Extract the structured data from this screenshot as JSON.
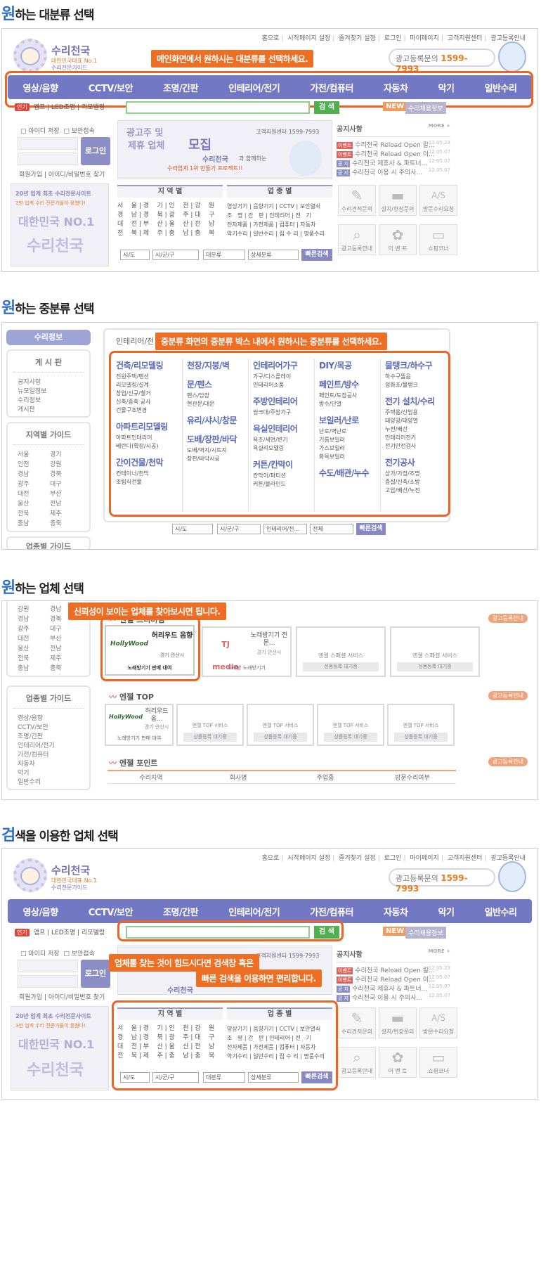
{
  "sections": [
    {
      "title_first": "원",
      "title_rest": "하는 대분류 선택"
    },
    {
      "title_first": "원",
      "title_rest": "하는 중분류 선택"
    },
    {
      "title_first": "원",
      "title_rest": "하는 업체 선택"
    },
    {
      "title_first": "검",
      "title_rest": "색을 이용한 업체 선택"
    }
  ],
  "util_links": [
    "홈으로",
    "시작페이지 설정",
    "즐겨찾기 설정",
    "로그인",
    "마이페이지",
    "고객지원센터",
    "광고등록안내"
  ],
  "logo": {
    "name": "수리천국",
    "tagline1": "대한민국대표 No.1",
    "tagline2": "수리전문가이드"
  },
  "ad_inquiry": {
    "label": "광고등록문의",
    "phone": "1599-7993"
  },
  "callouts": {
    "main": "메인화면에서 원하시는 대분류를 선택하세요.",
    "middle": "중분류 화면의 중분류 박스 내에서 원하시는 중분류를 선택하세요.",
    "company": "신뢰성이 보이는 업체를 찾아보시면 됩니다.",
    "search_line1": "업체를 찾는 것이 힘드시다면 검색창 혹은",
    "search_line2": "빠른 검색을 이용하면 편리합니다."
  },
  "nav": [
    "영상/음향",
    "CCTV/보안",
    "조명/간판",
    "인테리어/전기",
    "가전/컴퓨터",
    "자동차",
    "악기",
    "일반수리"
  ],
  "subrow": {
    "tag": "인기",
    "links": "엡프 | LED조명 | 리모델링"
  },
  "search_button": "검 색",
  "new_badge": "NEW",
  "new_label": "수리채용정보",
  "login": {
    "save_id": "아이디 저장",
    "secure": "보안접속",
    "button": "로그인",
    "links": "회원가입  |  아이디/비밀번호 찾기"
  },
  "promo": {
    "line1": "광고주 및",
    "line2": "제휴 업체",
    "big": "모집",
    "center": "고객지원센터 1599-7993",
    "brand": "수리천국",
    "slogan": "과 함께하는",
    "slogan2": "수리업계 1위 만들기 프로젝트!!"
  },
  "side_promo": {
    "line": "20년 업계 최초 수리전문사이트",
    "line2": "3만 업계 수리 전문가들이 뭉쳤다!",
    "big": "대한민국 NO.1",
    "name": "수리천국"
  },
  "notice": {
    "title": "공지사항",
    "more": "MORE +",
    "rows": [
      {
        "badge": "이벤트",
        "color": "#e2625b",
        "text": "수리천국 Reload Open 칼...",
        "date": "12.05.23"
      },
      {
        "badge": "이벤트",
        "color": "#e2625b",
        "text": "수리천국 Reload Open 이...",
        "date": "12.05.07"
      },
      {
        "badge": "공 지",
        "color": "#8a8fc4",
        "text": "수리천국 제휴사 & 파트너...",
        "date": "12.05.07"
      },
      {
        "badge": "공 지",
        "color": "#8a8fc4",
        "text": "수리천국 이용 시 주의사...",
        "date": "12.05.07"
      }
    ]
  },
  "region": {
    "title": "지 역 별",
    "grid": "서    울 | 경    기 | 인    천 | 강    원\n경    남 | 경    북 | 광    주 | 대    구\n대    전 | 부    산 | 울    산 | 전    남\n전    북 | 제    주 | 충    남 | 충    북"
  },
  "industry": {
    "title": "업 종 별",
    "grid": "영상기기 | 음향기기 | CCTV | 보안열쇠\n조   명 | 간   판 | 인테리어 | 전   기\n전자제품 | 가전제품 | 컴퓨터 | 자동차\n악기수리 | 일반수리 | 집 수 리 | 명품수리"
  },
  "filters": {
    "sido": "시/도",
    "gungu": "시/군/구",
    "major": "대분류",
    "detail": "상세분류",
    "quick": "빠른검색"
  },
  "icons": [
    {
      "name": "wrench-icon",
      "label": "수리견적문의",
      "glyph": "🔧"
    },
    {
      "name": "truck-icon",
      "label": "설치/현장문의",
      "glyph": "🚚"
    },
    {
      "name": "as-icon",
      "label": "방문수리요청",
      "glyph": "A/S"
    },
    {
      "name": "magnifier-icon",
      "label": "광고등록안내",
      "glyph": "🔍"
    },
    {
      "name": "gift-icon",
      "label": "이 벤 트",
      "glyph": "🎁"
    },
    {
      "name": "cart-icon",
      "label": "쇼핑코너",
      "glyph": "🛒"
    }
  ],
  "side_menu": {
    "header": "수리정보",
    "board_title": "게 시 판",
    "board": [
      "공지사항",
      "뉴모일정보",
      "수리정보",
      "게시판"
    ],
    "region_title": "지역별 가이드",
    "regions": [
      [
        "서울",
        "경기"
      ],
      [
        "인천",
        "강원"
      ],
      [
        "경남",
        "경북"
      ],
      [
        "광주",
        "대구"
      ],
      [
        "대전",
        "부산"
      ],
      [
        "울산",
        "전남"
      ],
      [
        "전북",
        "제주"
      ],
      [
        "충남",
        "충북"
      ]
    ],
    "industry_title": "업종별 가이드",
    "industries": [
      "영상/음향",
      "CCTV/보안",
      "조명/간판",
      "인테리어/전기",
      "가전/컴퓨터",
      "자동차",
      "악기",
      "일반수리"
    ]
  },
  "middle_header": "인테리어/전",
  "middle_cols": [
    [
      {
        "g": "건축/리모델링",
        "s": [
          "전원주택/펜션",
          "리모델링/설계",
          "창업/신규/철거",
          "신축/증축 공사",
          "건물구조변경"
        ]
      },
      {
        "g": "아파트리모델링",
        "s": [
          "아파트인테리어",
          "베란다(확장/시공)"
        ]
      },
      {
        "g": "간이건물/천막",
        "s": [
          "컨테이너/천막",
          "조립식건물"
        ]
      }
    ],
    [
      {
        "g": "천장/지붕/벽",
        "s": []
      },
      {
        "g": "문/펜스",
        "s": [
          "펜스/담장",
          "현관문/대문"
        ]
      },
      {
        "g": "유리/샤시/창문",
        "s": []
      },
      {
        "g": "도배/장판/바닥",
        "s": [
          "도배/벽지/시트지",
          "장판/바닥시공"
        ]
      }
    ],
    [
      {
        "g": "인테리어가구",
        "s": [
          "가구/디스플레이",
          "인테리어소품"
        ]
      },
      {
        "g": "주방인테리어",
        "s": [
          "씽크대/주방가구"
        ]
      },
      {
        "g": "욕실인테리어",
        "s": [
          "욕조/세면/변기",
          "욕실리모델링"
        ]
      },
      {
        "g": "커튼/칸막이",
        "s": [
          "칸막이/파티션",
          "커튼/블라인드"
        ]
      }
    ],
    [
      {
        "g": "DIY/목공",
        "s": []
      },
      {
        "g": "페인트/방수",
        "s": [
          "페인트/도장공사",
          "방수/단열"
        ]
      },
      {
        "g": "보일러/난로",
        "s": [
          "난로/벽난로",
          "기름보일러",
          "가스보일러",
          "화목보일러"
        ]
      },
      {
        "g": "수도/배관/누수",
        "s": []
      }
    ],
    [
      {
        "g": "물탱크/하수구",
        "s": [
          "하수구뚫음",
          "정화조/물탱크"
        ]
      },
      {
        "g": "전기 설치/수리",
        "s": [
          "주택용/산업용",
          "태양광/태양열",
          "누전/배선",
          "인테리어전기",
          "전기안전검사"
        ]
      },
      {
        "g": "전기공사",
        "s": [
          "상가/가정/조명",
          "증설/신축/소방",
          "고압/배선/누전"
        ]
      }
    ]
  ],
  "middle_filters": {
    "sido": "시/도",
    "gungu": "시/군/구",
    "major": "인테리어/전...",
    "all": "전체",
    "quick": "빠른검색"
  },
  "company": {
    "angel_premium": "엔젤 프리미엄",
    "angel_top": "엔젤 TOP",
    "angel_point": "엔젤 포인트",
    "reg_badge": "광고등록안내",
    "premium_name": "허리우드 음향",
    "premium_loc": "경기 안산시",
    "premium_cap": "노래방기기 판매 대여",
    "premium_logo": "HollyWood",
    "tj_logo": "TJ media",
    "tj_name": "노래방기기 전문...",
    "tj_loc": "경기 안산시",
    "tj_cap": "노래방 노래방기기",
    "service_title": "엔젤 스페셜 서비스",
    "service_cap": "상품등록 대기중",
    "top_name": "허리우드 음...",
    "top_loc": "경기 안산시",
    "top_cap": "노래방기기 판매 대여",
    "top_service": "엔젤 TOP 서비스",
    "top_service_cap": "상품등록 대기중",
    "point_cols": [
      "수리지역",
      "회사명",
      "주업종",
      "방문수리여부"
    ],
    "regions_top": [
      [
        "강원",
        "경남"
      ],
      [
        "경남",
        "경북"
      ],
      [
        "광주",
        "대구"
      ],
      [
        "대전",
        "부산"
      ],
      [
        "울산",
        "전남"
      ],
      [
        "전북",
        "제주"
      ],
      [
        "충남",
        "충북"
      ]
    ]
  },
  "colors": {
    "accent": "#ee6424",
    "nav": "#7378c4",
    "title": "#2f6fc7"
  }
}
